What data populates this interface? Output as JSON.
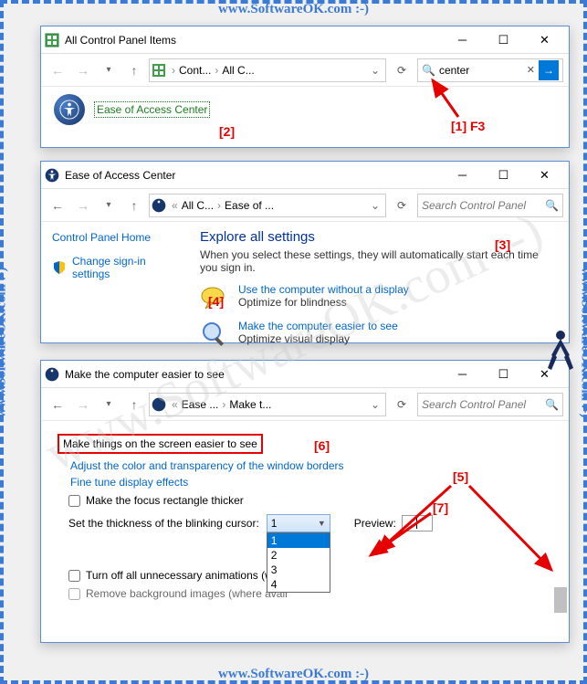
{
  "watermark": "www.SoftwareOK.com :-)",
  "win1": {
    "title": "All Control Panel Items",
    "addr": {
      "seg1": "Cont...",
      "seg2": "All C..."
    },
    "search_value": "center",
    "result_label": "Ease of Access Center"
  },
  "win2": {
    "title": "Ease of Access Center",
    "addr": {
      "seg1": "All C...",
      "seg2": "Ease of ..."
    },
    "search_placeholder": "Search Control Panel",
    "left_links": {
      "home": "Control Panel Home",
      "signin": "Change sign-in settings"
    },
    "heading": "Explore all settings",
    "desc": "When you select these settings, they will automatically start each time you sign in.",
    "opt1_link": "Use the computer without a display",
    "opt1_sub": "Optimize for blindness",
    "opt2_link": "Make the computer easier to see",
    "opt2_sub": "Optimize visual display"
  },
  "win3": {
    "title": "Make the computer easier to see",
    "addr": {
      "seg1": "Ease ...",
      "seg2": "Make t..."
    },
    "search_placeholder": "Search Control Panel",
    "section": "Make things on the screen easier to see",
    "link1": "Adjust the color and transparency of the window borders",
    "link2": "Fine tune display effects",
    "chk1": "Make the focus rectangle thicker",
    "cursor_label": "Set the thickness of the blinking cursor:",
    "select_value": "1",
    "options": [
      "1",
      "2",
      "3",
      "4"
    ],
    "preview_label": "Preview:",
    "chk2": "Turn off all unnecessary animations (whe",
    "chk3": "Remove background images (where avail"
  },
  "callouts": {
    "c1": "[1] F3",
    "c2": "[2]",
    "c3": "[3]",
    "c4": "[4]",
    "c5": "[5]",
    "c6": "[6]",
    "c7": "[7]"
  }
}
